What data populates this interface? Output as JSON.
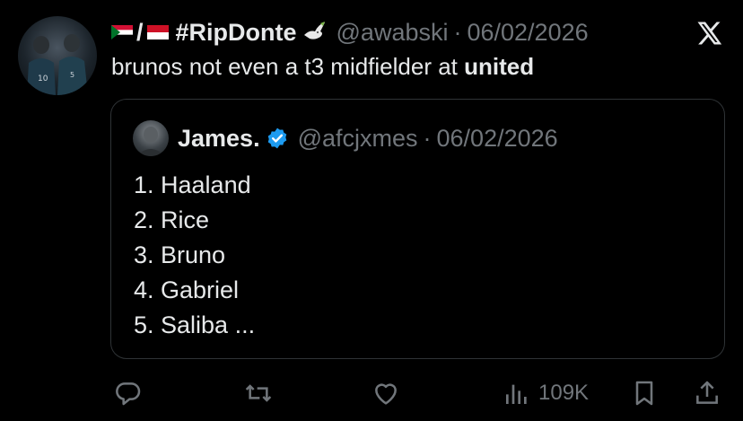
{
  "author": {
    "display_name": "#RipDonte",
    "handle": "@awabski",
    "date": "06/02/2026",
    "flags": [
      "sudan-flag",
      "indonesia-flag"
    ],
    "emoji": "dove-icon"
  },
  "tweet": {
    "text_prefix": "brunos not even a t3 midfielder at ",
    "text_bold": "united"
  },
  "quoted": {
    "display_name": "James.",
    "handle": "@afcjxmes",
    "date": "06/02/2026",
    "verified": true,
    "lines": [
      "1. Haaland",
      "2. Rice",
      "3. Bruno",
      "4. Gabriel",
      "5. Saliba ..."
    ]
  },
  "actions": {
    "views": "109K"
  },
  "colors": {
    "background": "#000000",
    "text": "#e7e9ea",
    "muted": "#71767b",
    "border": "#2f3336",
    "verified": "#1d9bf0"
  }
}
